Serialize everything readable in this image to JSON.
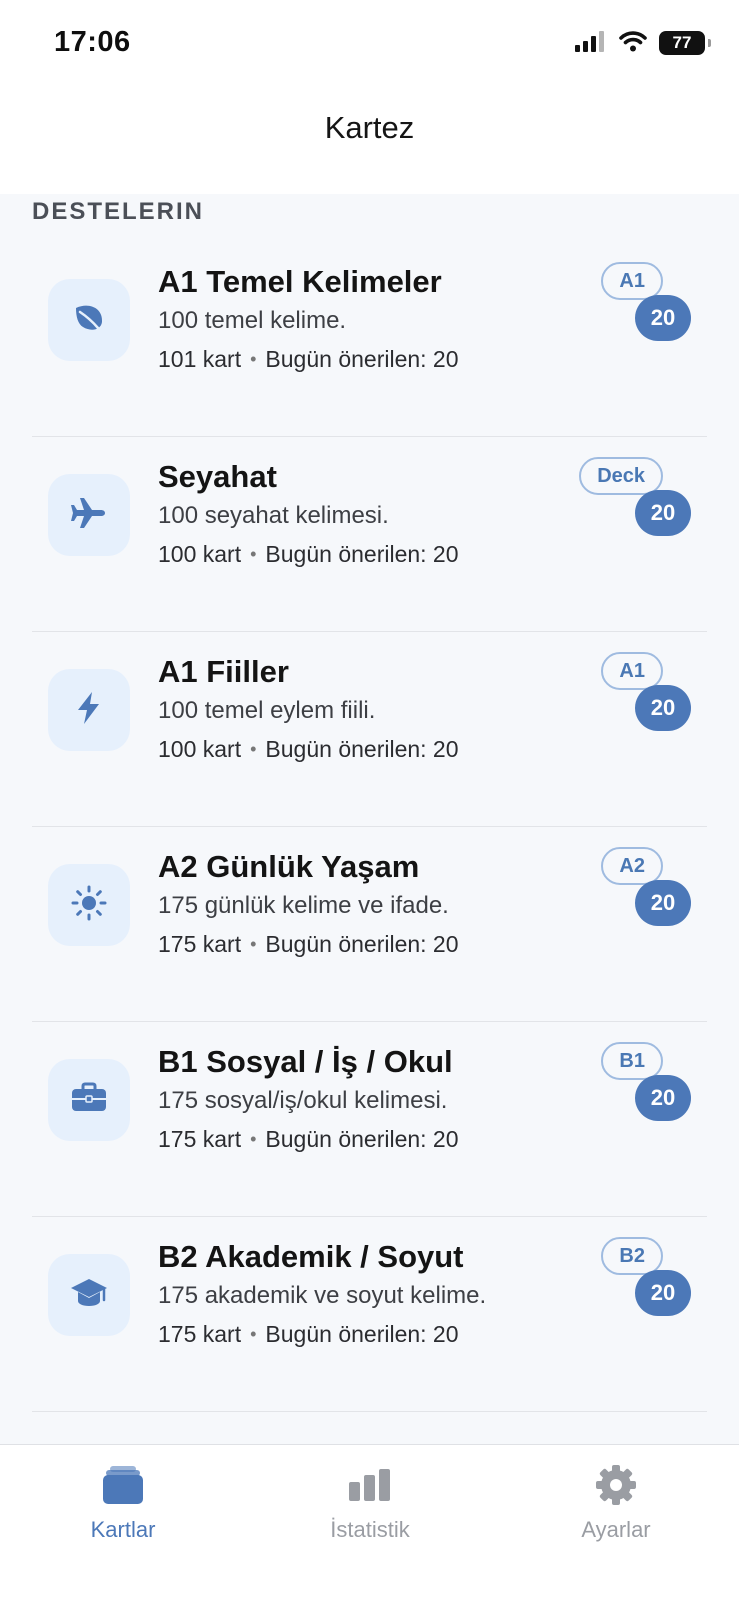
{
  "status_bar": {
    "time": "17:06",
    "battery": "77"
  },
  "nav": {
    "title": "Kartez"
  },
  "section": {
    "header": "DESTELERIN"
  },
  "decks": [
    {
      "icon": "leaf-icon",
      "title": "A1 Temel Kelimeler",
      "description": "100 temel kelime.",
      "cards": "101 kart",
      "suggested": "Bugün önerilen: 20",
      "level": "A1",
      "count": "20"
    },
    {
      "icon": "airplane-icon",
      "title": "Seyahat",
      "description": "100 seyahat kelimesi.",
      "cards": "100 kart",
      "suggested": "Bugün önerilen: 20",
      "level": "Deck",
      "count": "20"
    },
    {
      "icon": "bolt-icon",
      "title": "A1 Fiiller",
      "description": "100 temel eylem fiili.",
      "cards": "100 kart",
      "suggested": "Bugün önerilen: 20",
      "level": "A1",
      "count": "20"
    },
    {
      "icon": "sun-icon",
      "title": "A2 Günlük Yaşam",
      "description": "175 günlük kelime ve ifade.",
      "cards": "175 kart",
      "suggested": "Bugün önerilen: 20",
      "level": "A2",
      "count": "20"
    },
    {
      "icon": "briefcase-icon",
      "title": "B1 Sosyal / İş / Okul",
      "description": "175 sosyal/iş/okul kelimesi.",
      "cards": "175 kart",
      "suggested": "Bugün önerilen: 20",
      "level": "B1",
      "count": "20"
    },
    {
      "icon": "graduation-cap-icon",
      "title": "B2 Akademik / Soyut",
      "description": "175 akademik ve soyut kelime.",
      "cards": "175 kart",
      "suggested": "Bugün önerilen: 20",
      "level": "B2",
      "count": "20"
    }
  ],
  "tab_bar": {
    "tabs": [
      {
        "label": "Kartlar",
        "icon": "cards-stack-icon",
        "active": true
      },
      {
        "label": "İstatistik",
        "icon": "bar-chart-icon",
        "active": false
      },
      {
        "label": "Ayarlar",
        "icon": "gear-icon",
        "active": false
      }
    ]
  },
  "colors": {
    "accent": "#4c78b8",
    "icon_bg": "#e6f0fc",
    "background": "#f6f8fb",
    "inactive": "#9a9da3"
  }
}
